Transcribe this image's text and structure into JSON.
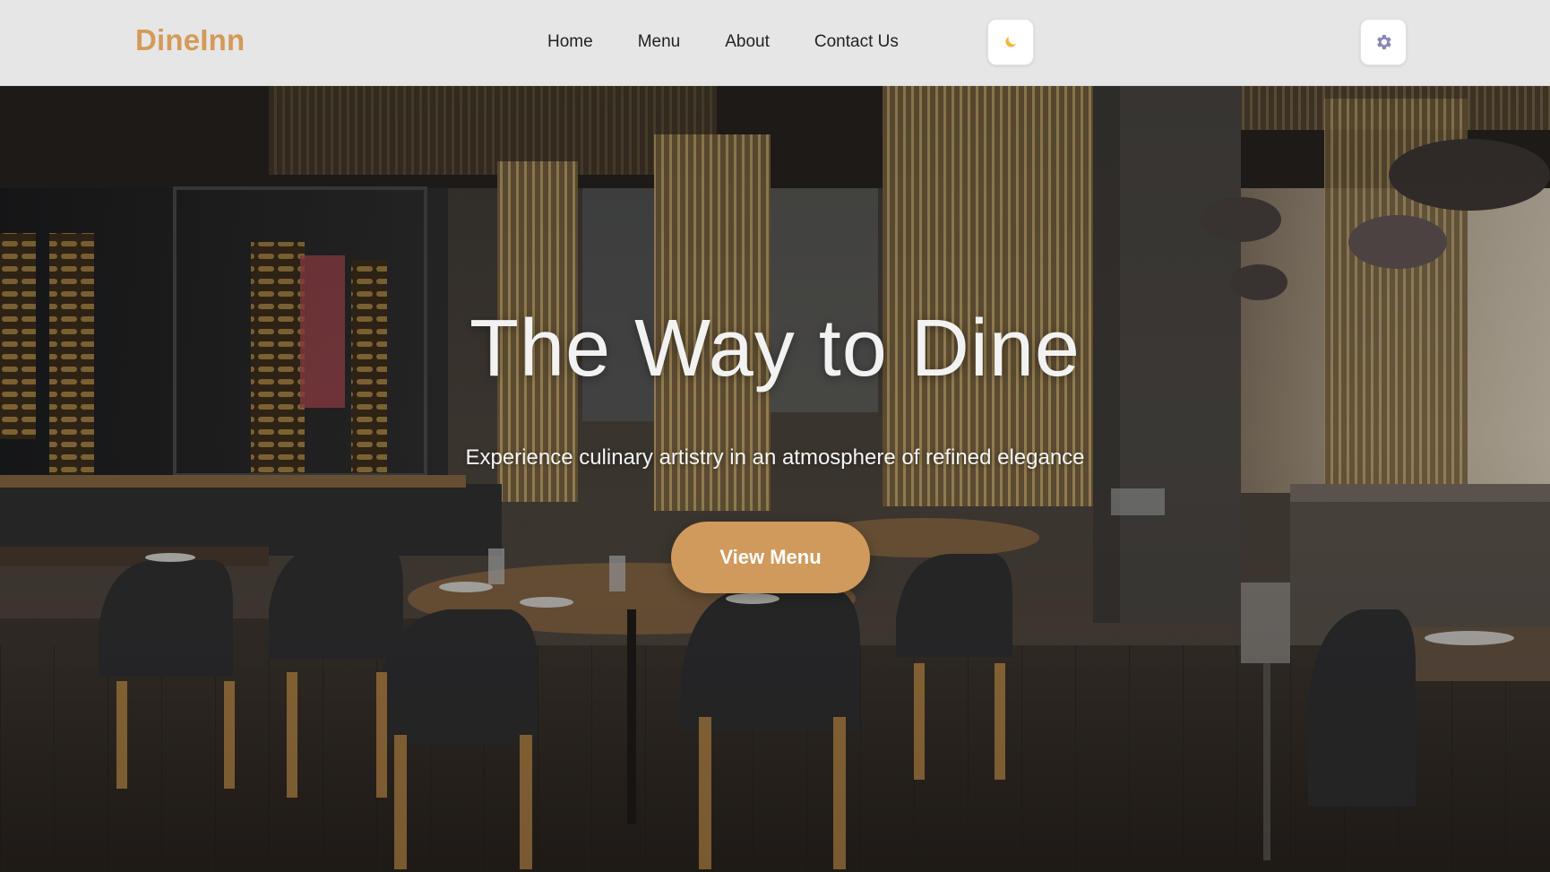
{
  "brand": {
    "name": "DineInn",
    "color": "#d49a58"
  },
  "nav": {
    "links": [
      {
        "label": "Home"
      },
      {
        "label": "Menu"
      },
      {
        "label": "About"
      },
      {
        "label": "Contact Us"
      }
    ],
    "theme_toggle_icon": "moon-icon",
    "settings_icon": "gear-icon"
  },
  "hero": {
    "title": "The Way to Dine",
    "subtitle": "Experience culinary artistry in an atmosphere of refined elegance",
    "cta_label": "View Menu",
    "background_image": "restaurant-interior-photo",
    "accent_color": "#cf9a5c"
  }
}
